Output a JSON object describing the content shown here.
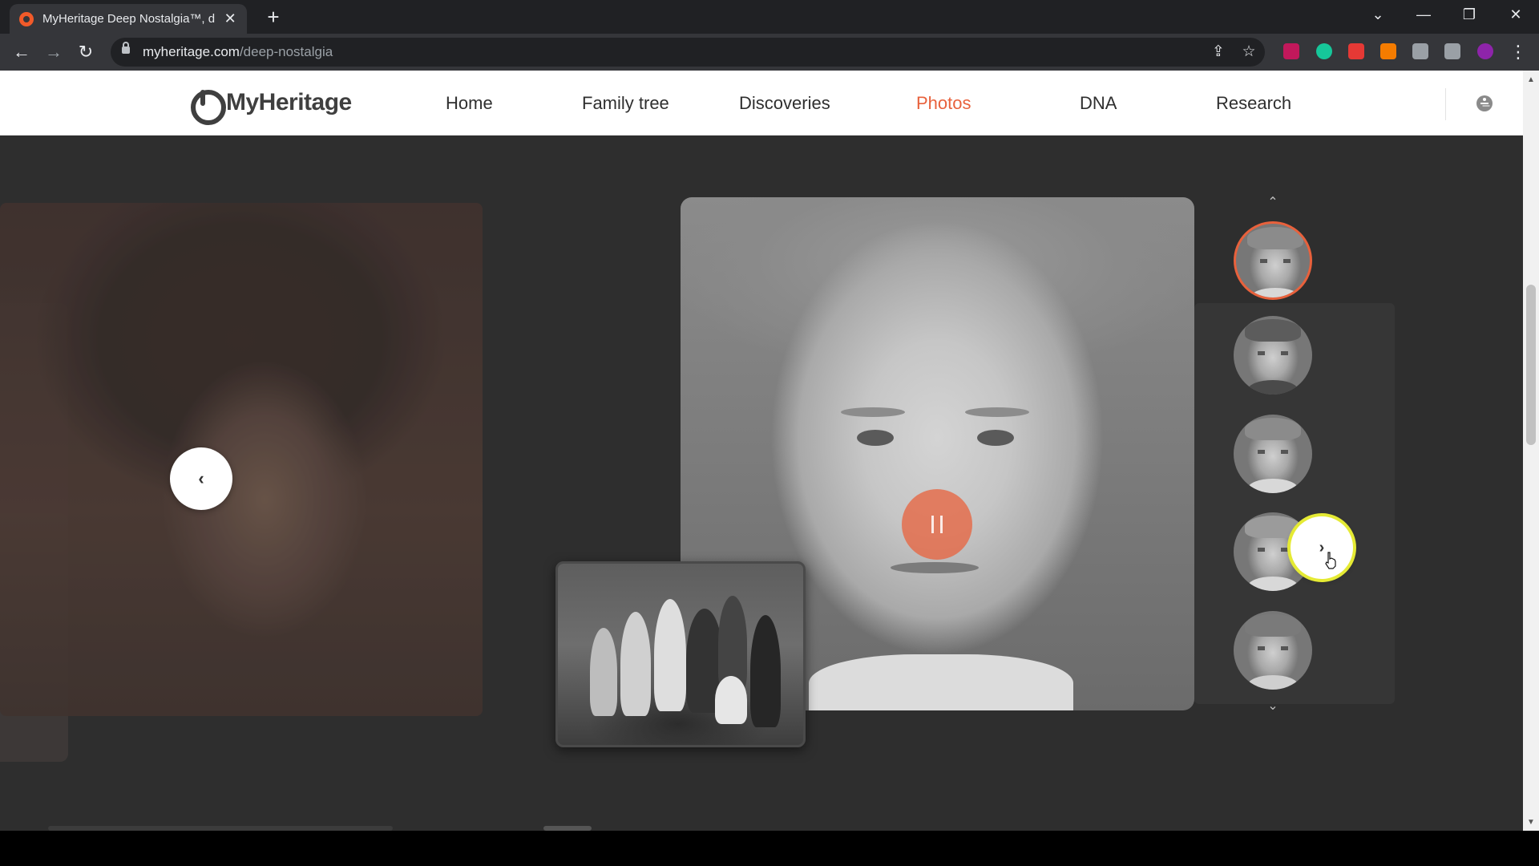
{
  "browser": {
    "tab_title": "MyHeritage Deep Nostalgia™, de",
    "tab_close": "✕",
    "new_tab": "+",
    "url_host": "myheritage.com",
    "url_path": "/deep-nostalgia",
    "nav": {
      "back": "←",
      "forward": "→",
      "reload": "↻"
    },
    "window": {
      "tab_search": "⌄",
      "minimize": "—",
      "restore": "❐",
      "close": "✕"
    },
    "omnibox_icons": {
      "share": "⇪",
      "star": "☆"
    },
    "menu": "⋮",
    "extension_colors": [
      "#c2185b",
      "#16c79a",
      "#e53935",
      "#f57c00",
      "#9aa0a6",
      "#9aa0a6",
      "#8e24aa"
    ]
  },
  "header": {
    "logo_text": "MyHeritage",
    "nav_items": [
      {
        "label": "Home",
        "active": false
      },
      {
        "label": "Family tree",
        "active": false
      },
      {
        "label": "Discoveries",
        "active": false
      },
      {
        "label": "Photos",
        "active": true
      },
      {
        "label": "DNA",
        "active": false
      },
      {
        "label": "Research",
        "active": false
      }
    ],
    "accent_color": "#e8613c"
  },
  "carousel": {
    "prev_glyph": "‹",
    "next_glyph": "›",
    "thumb_up": "⌃",
    "thumb_down": "⌄",
    "thumbnail_count": 5,
    "active_thumbnail": 1
  }
}
